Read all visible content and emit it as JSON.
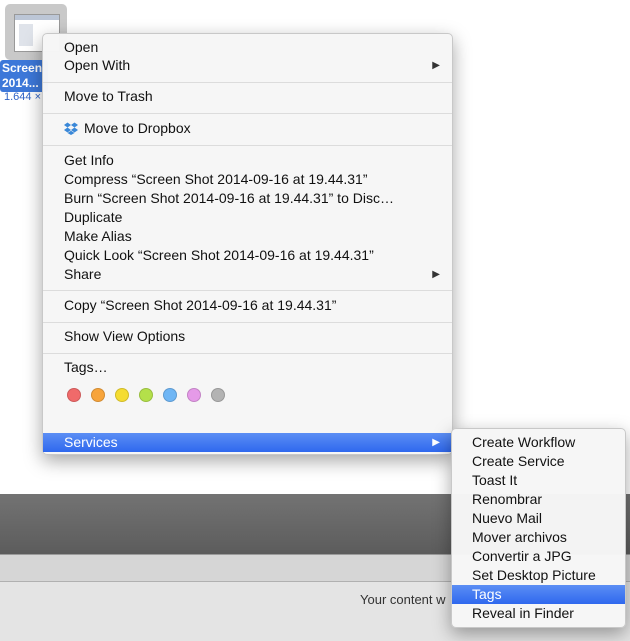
{
  "desktop": {
    "file_label": "Screen\n2014...",
    "file_label_line1": "Screen",
    "file_label_line2": "2014...",
    "file_size": "1.644 ×"
  },
  "background_window": {
    "text": "Your content w"
  },
  "menu": {
    "open": "Open",
    "open_with": "Open With",
    "move_to_trash": "Move to Trash",
    "move_to_dropbox": "Move to Dropbox",
    "get_info": "Get Info",
    "compress": "Compress “Screen Shot 2014-09-16 at 19.44.31”",
    "burn": "Burn “Screen Shot 2014-09-16 at 19.44.31” to Disc…",
    "duplicate": "Duplicate",
    "make_alias": "Make Alias",
    "quick_look": "Quick Look “Screen Shot 2014-09-16 at 19.44.31”",
    "share": "Share",
    "copy": "Copy “Screen Shot 2014-09-16 at 19.44.31”",
    "show_view_options": "Show View Options",
    "tags": "Tags…",
    "services": "Services",
    "submenu_arrow": "▶"
  },
  "tag_colors": [
    "#f06a6a",
    "#f7a43b",
    "#f5dc31",
    "#b4e04a",
    "#6fb6f5",
    "#e59ae8",
    "#b3b3b3"
  ],
  "services_submenu": {
    "items": [
      "Create Workflow",
      "Create Service",
      "Toast It",
      "Renombrar",
      "Nuevo Mail",
      "Mover archivos",
      "Convertir a JPG",
      "Set Desktop Picture",
      "Tags",
      "Reveal in Finder"
    ],
    "highlighted": "Tags"
  },
  "colors": {
    "highlight": "#3b73ef",
    "selection_label": "#3d78d9"
  }
}
